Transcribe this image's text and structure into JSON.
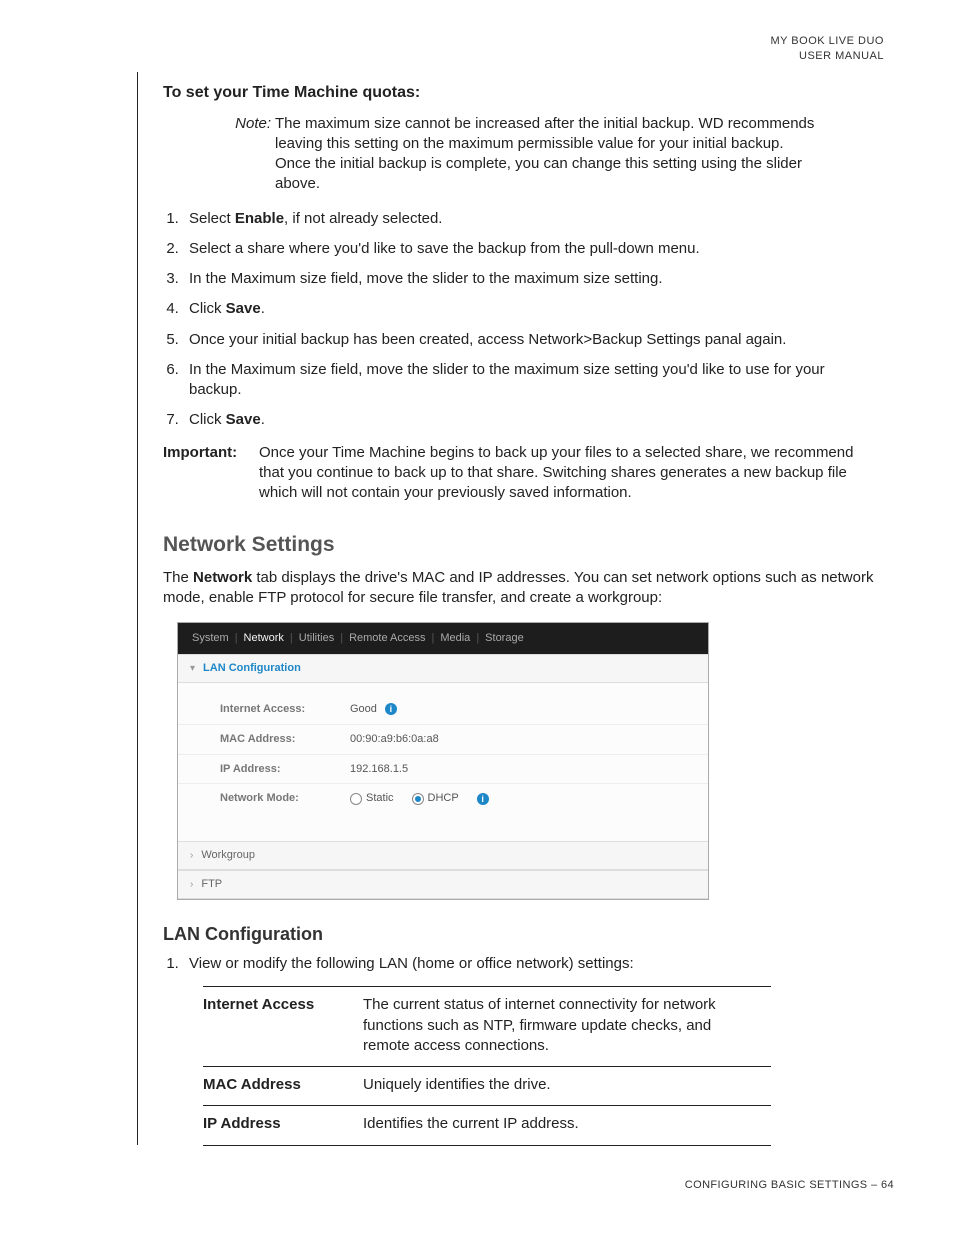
{
  "header": {
    "line1": "MY BOOK LIVE DUO",
    "line2": "USER MANUAL"
  },
  "tm_heading": "To set your Time Machine quotas:",
  "note": {
    "label": "Note:",
    "body": "The maximum size cannot be increased after the initial backup. WD recommends leaving this setting on the maximum permissible value for your initial backup. Once the initial backup is complete, you can change this setting using the slider above."
  },
  "steps": [
    {
      "pre": "Select ",
      "bold": "Enable",
      "post": ", if not already selected."
    },
    {
      "pre": "Select a share where you'd like to save the backup from the pull-down menu.",
      "bold": "",
      "post": ""
    },
    {
      "pre": "In the Maximum size field, move the slider to the maximum size setting.",
      "bold": "",
      "post": ""
    },
    {
      "pre": "Click ",
      "bold": "Save",
      "post": "."
    },
    {
      "pre": "Once your initial backup has been created, access Network>Backup Settings panal again.",
      "bold": "",
      "post": ""
    },
    {
      "pre": "In the Maximum size field, move the slider to the maximum size setting you'd like to use for your backup.",
      "bold": "",
      "post": ""
    },
    {
      "pre": "Click ",
      "bold": "Save",
      "post": "."
    }
  ],
  "important": {
    "label": "Important:",
    "body": "Once your Time Machine begins to back up your files to a selected share, we recommend that you continue to back up to that share. Switching shares generates a new backup file which will not contain your previously saved information."
  },
  "network": {
    "heading": "Network Settings",
    "intro_pre": "The ",
    "intro_bold": "Network",
    "intro_post": " tab displays the drive's MAC and IP addresses. You can set network options such as network mode, enable FTP protocol for secure file transfer, and create a workgroup:"
  },
  "ui": {
    "tabs": [
      "System",
      "Network",
      "Utilities",
      "Remote Access",
      "Media",
      "Storage"
    ],
    "active_tab_index": 1,
    "sections": {
      "lan": "LAN Configuration",
      "workgroup": "Workgroup",
      "ftp": "FTP"
    },
    "fields": {
      "internet_label": "Internet Access:",
      "internet_value": "Good",
      "mac_label": "MAC Address:",
      "mac_value": "00:90:a9:b6:0a:a8",
      "ip_label": "IP Address:",
      "ip_value": "192.168.1.5",
      "mode_label": "Network Mode:",
      "mode_static": "Static",
      "mode_dhcp": "DHCP"
    }
  },
  "lan": {
    "heading": "LAN Configuration",
    "step1": "View or modify the following LAN (home or office network) settings:"
  },
  "def": [
    {
      "term": "Internet Access",
      "desc": "The current status of internet connectivity for network functions such as NTP, firmware update checks, and remote access connections."
    },
    {
      "term": "MAC Address",
      "desc": "Uniquely identifies the drive."
    },
    {
      "term": "IP Address",
      "desc": "Identifies the current IP address."
    }
  ],
  "footer": "CONFIGURING BASIC SETTINGS – 64"
}
